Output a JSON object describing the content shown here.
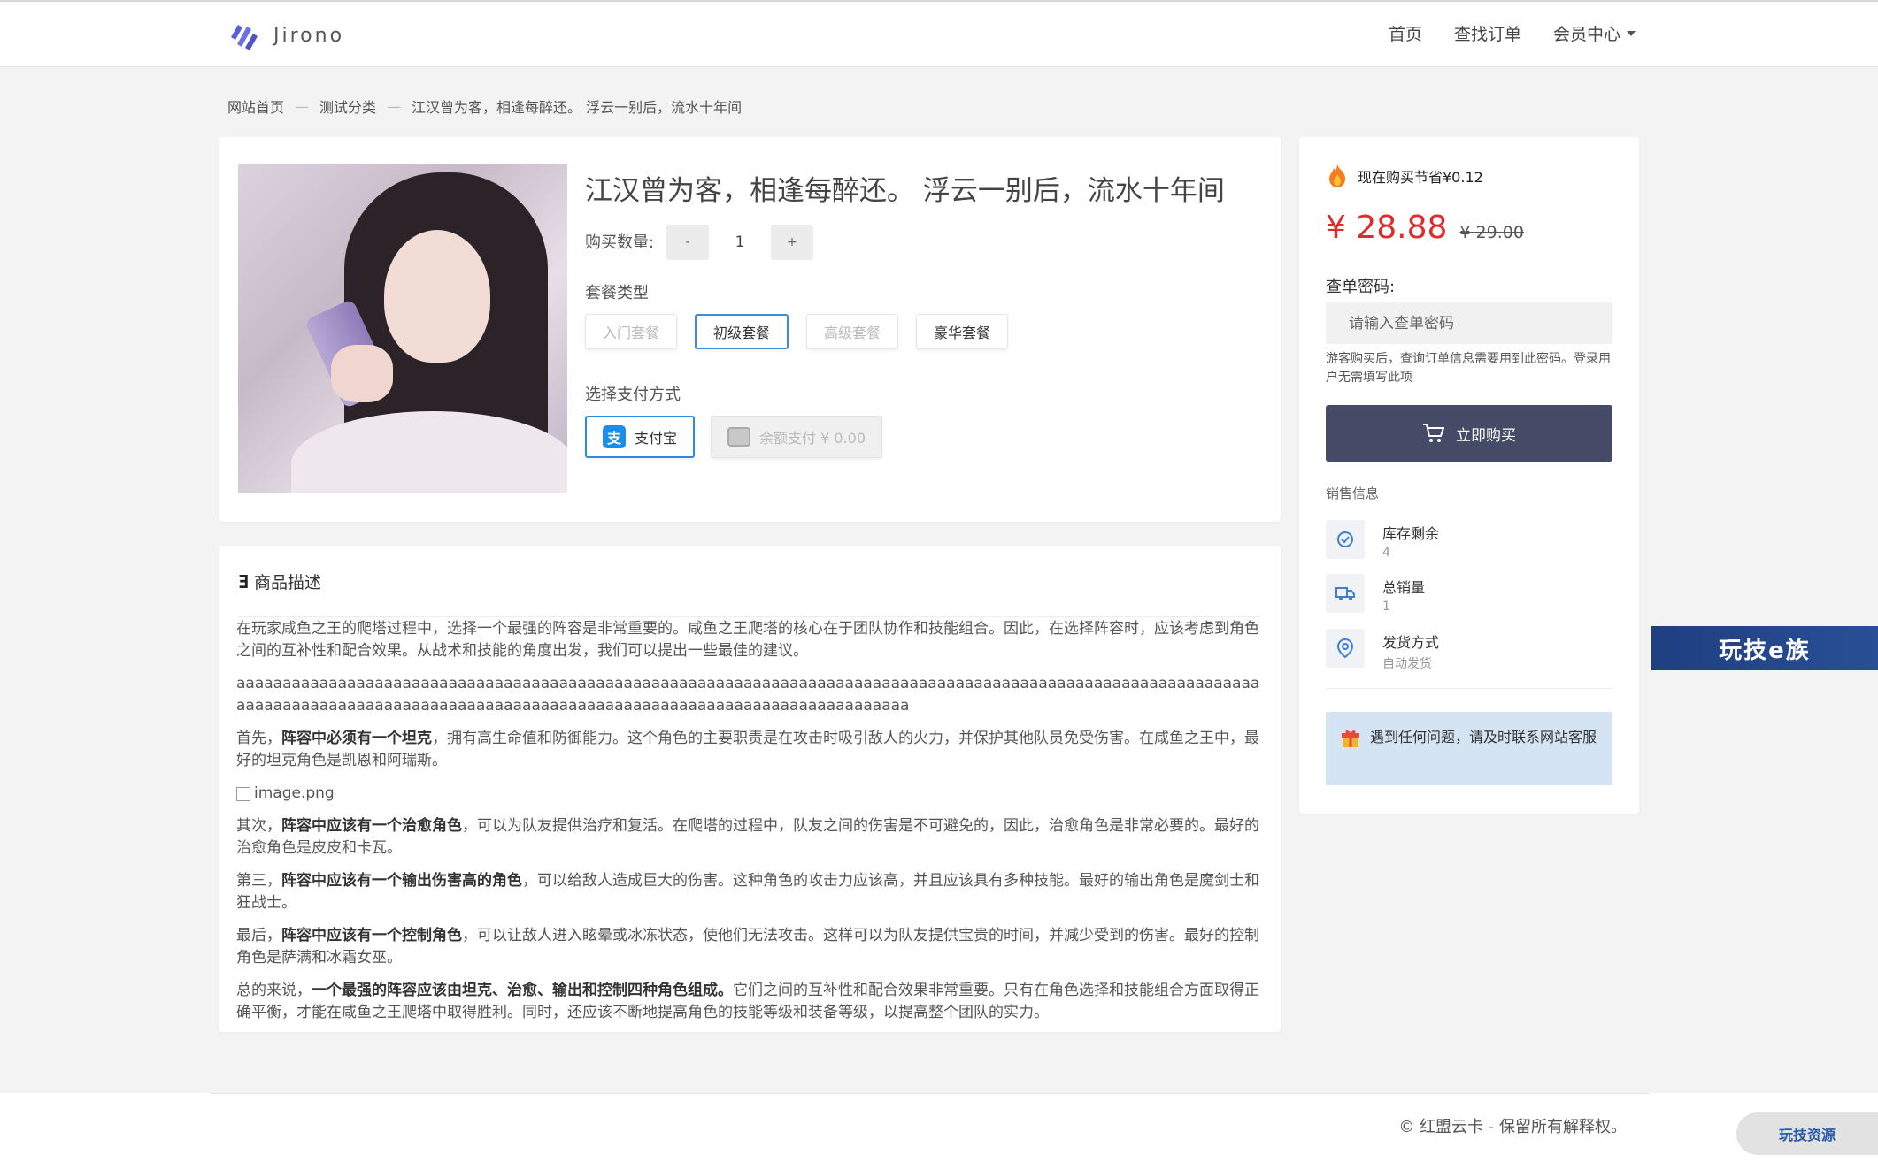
{
  "header": {
    "logo_text": "Jirono",
    "nav": [
      "首页",
      "查找订单",
      "会员中心"
    ]
  },
  "breadcrumb": [
    "网站首页",
    "测试分类",
    "江汉曾为客，相逢每醉还。 浮云一别后，流水十年间"
  ],
  "product": {
    "title": "江汉曾为客，相逢每醉还。 浮云一别后，流水十年间",
    "qty_label": "购买数量:",
    "qty_minus": "-",
    "qty_value": "1",
    "qty_plus": "+",
    "package_label": "套餐类型",
    "packages": [
      "入门套餐",
      "初级套餐",
      "高级套餐",
      "豪华套餐"
    ],
    "payment_label": "选择支付方式",
    "payments": {
      "alipay_icon": "支",
      "alipay": "支付宝",
      "balance": "余额支付 ¥ 0.00"
    }
  },
  "description": {
    "title": "商品描述",
    "p1": "在玩家咸鱼之王的爬塔过程中，选择一个最强的阵容是非常重要的。咸鱼之王爬塔的核心在于团队协作和技能组合。因此，在选择阵容时，应该考虑到角色之间的互补性和配合效果。从战术和技能的角度出发，我们可以提出一些最佳的建议。",
    "p2": "aaaaaaaaaaaaaaaaaaaaaaaaaaaaaaaaaaaaaaaaaaaaaaaaaaaaaaaaaaaaaaaaaaaaaaaaaaaaaaaaaaaaaaaaaaaaaaaaaaaaaaaaaaaaaaaaaaaaaaaaaaaaaaaaaaaaaaaaaaaaaaaaaaaaaaaaaaaaaaaaaaaaaaaaaaaaaaaaaaaaaaaa",
    "p3_pre": "首先，",
    "p3_bold": "阵容中必须有一个坦克",
    "p3_post": "，拥有高生命值和防御能力。这个角色的主要职责是在攻击时吸引敌人的火力，并保护其他队员免受伤害。在咸鱼之王中，最好的坦克角色是凯恩和阿瑞斯。",
    "image_alt": "image.png",
    "p4_pre": "其次，",
    "p4_bold": "阵容中应该有一个治愈角色",
    "p4_post": "，可以为队友提供治疗和复活。在爬塔的过程中，队友之间的伤害是不可避免的，因此，治愈角色是非常必要的。最好的治愈角色是皮皮和卡瓦。",
    "p5_pre": "第三，",
    "p5_bold": "阵容中应该有一个输出伤害高的角色",
    "p5_post": "，可以给敌人造成巨大的伤害。这种角色的攻击力应该高，并且应该具有多种技能。最好的输出角色是魔剑士和狂战士。",
    "p6_pre": "最后，",
    "p6_bold": "阵容中应该有一个控制角色",
    "p6_post": "，可以让敌人进入眩晕或冰冻状态，使他们无法攻击。这样可以为队友提供宝贵的时间，并减少受到的伤害。最好的控制角色是萨满和冰霜女巫。",
    "p7_pre": "总的来说，",
    "p7_bold": "一个最强的阵容应该由坦克、治愈、输出和控制四种角色组成。",
    "p7_post": "它们之间的互补性和配合效果非常重要。只有在角色选择和技能组合方面取得正确平衡，才能在咸鱼之王爬塔中取得胜利。同时，还应该不断地提高角色的技能等级和装备等级，以提高整个团队的实力。"
  },
  "sidebar": {
    "save_text": "现在购买节省¥0.12",
    "price_now": "¥ 28.88",
    "price_old": "¥ 29.00",
    "password_label": "查单密码:",
    "password_placeholder": "请输入查单密码",
    "password_hint": "游客购买后，查询订单信息需要用到此密码。登录用户无需填写此项",
    "buy_label": "立即购买",
    "sales_title": "销售信息",
    "stock_label": "库存剩余",
    "stock_value": "4",
    "sold_label": "总销量",
    "sold_value": "1",
    "ship_label": "发货方式",
    "ship_value": "自动发货",
    "notice": "遇到任何问题，请及时联系网站客服"
  },
  "ad_text": "玩技e族",
  "footer": {
    "copyright": "© 红盟云卡 - 保留所有解释权。",
    "badge": "玩技资源"
  },
  "colors": {
    "accent": "#454b67",
    "price": "#e02b2b",
    "active_border": "#3c8dd6",
    "notice_bg": "#d5e4f3"
  }
}
